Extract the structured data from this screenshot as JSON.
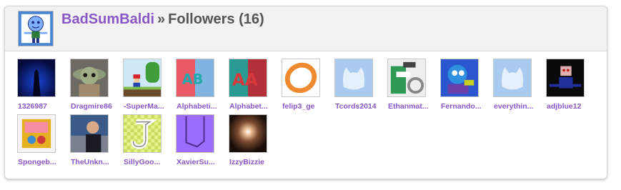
{
  "header": {
    "username": "BadSumBaldi",
    "separator": "»",
    "section": "Followers (16)"
  },
  "colors": {
    "link": "#8a58c6",
    "header_bg": "#f2f2f2",
    "text": "#555555"
  },
  "followers": [
    {
      "name": "1326987",
      "icon": "dark-blue-silhouette-thumbnail"
    },
    {
      "name": "Dragmire86",
      "icon": "baby-yoda-thumbnail"
    },
    {
      "name": "-SuperMa...",
      "icon": "mario-level-thumbnail"
    },
    {
      "name": "Alphabeti...",
      "icon": "alphabet-lore-b-thumbnail"
    },
    {
      "name": "Alphabet...",
      "icon": "alphabet-lore-a-thumbnail"
    },
    {
      "name": "felip3_ge",
      "icon": "orange-ring-thumbnail"
    },
    {
      "name": "Tcords2014",
      "icon": "default-cat-avatar"
    },
    {
      "name": "Ethanmat...",
      "icon": "alphabet-lore-letters-thumbnail"
    },
    {
      "name": "Fernando...",
      "icon": "blue-character-thumbnail"
    },
    {
      "name": "everythin...",
      "icon": "default-cat-avatar"
    },
    {
      "name": "adjblue12",
      "icon": "dark-character-thumbnail"
    },
    {
      "name": "Spongeb...",
      "icon": "spongebob-box-thumbnail"
    },
    {
      "name": "TheUnkn...",
      "icon": "man-speaking-thumbnail"
    },
    {
      "name": "SillyGoo...",
      "icon": "letter-j-checker-thumbnail"
    },
    {
      "name": "XavierSu...",
      "icon": "purple-drawing-thumbnail"
    },
    {
      "name": "IzzyBizzie",
      "icon": "light-glow-thumbnail"
    }
  ]
}
